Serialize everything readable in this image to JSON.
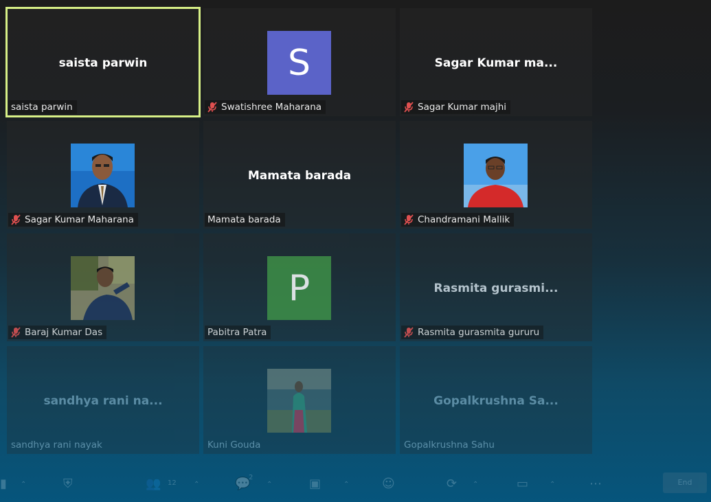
{
  "participants": [
    {
      "tile_name": "saista parwin",
      "label": "saista parwin",
      "muted": false,
      "active": true
    },
    {
      "avatar_letter": "S",
      "avatar_color": "#5b63c8",
      "label": "Swatishree Maharana",
      "muted": true
    },
    {
      "tile_name": "Sagar Kumar ma...",
      "label": "Sagar Kumar majhi",
      "muted": true
    },
    {
      "photo": "man-blue-background",
      "label": "Sagar Kumar Maharana",
      "muted": true
    },
    {
      "tile_name": "Mamata barada",
      "label": "Mamata barada",
      "muted": false
    },
    {
      "photo": "man-red-shirt",
      "label": "Chandramani Mallik",
      "muted": true
    },
    {
      "photo": "man-outdoor",
      "label": "Baraj Kumar Das",
      "muted": true
    },
    {
      "avatar_letter": "P",
      "avatar_color": "#3f8f46",
      "label": "Pabitra Patra",
      "muted": false
    },
    {
      "tile_name": "Rasmita  gurasmi...",
      "label": "Rasmita gurasmita gururu",
      "muted": true
    },
    {
      "tile_name": "sandhya rani na...",
      "label": "sandhya rani nayak",
      "muted": false
    },
    {
      "photo": "woman-festival",
      "label": "Kuni Gouda",
      "muted": false
    },
    {
      "tile_name": "Gopalkrushna  Sa...",
      "label": "Gopalkrushna Sahu",
      "muted": false
    }
  ],
  "toolbar": {
    "participants_count": "12",
    "chat_badge": "2",
    "end_label": "End"
  },
  "colors": {
    "active_border": "#d7f087",
    "mute_icon": "#e05050"
  }
}
